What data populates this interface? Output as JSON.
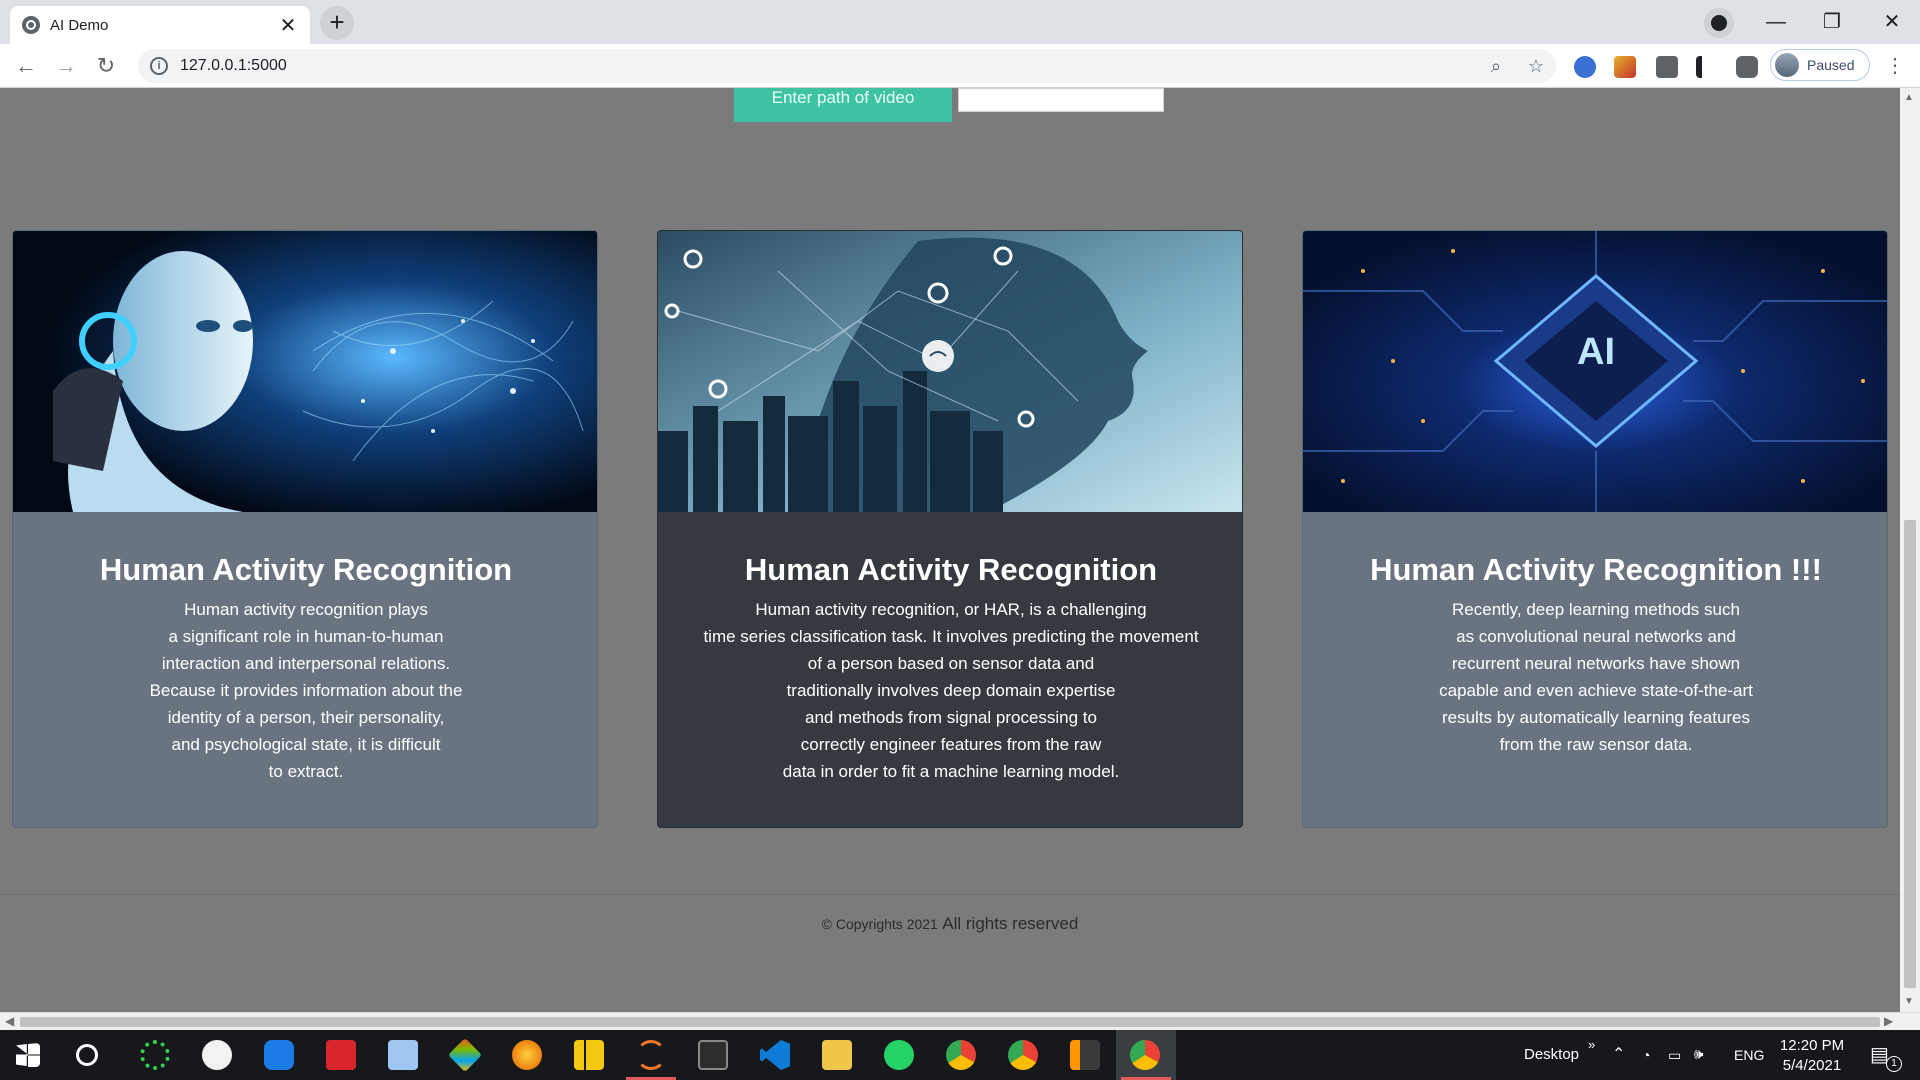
{
  "browser": {
    "tab_title": "AI Demo",
    "tab_close": "✕",
    "new_tab": "+",
    "url": "127.0.0.1:5000",
    "profile_label": "Paused",
    "window_minimize": "—",
    "window_restore": "❐",
    "window_close": "✕",
    "back": "←",
    "forward": "→",
    "reload": "↻",
    "menu": "⋮",
    "zoom_icon": "⌕",
    "star_icon": "☆"
  },
  "page": {
    "video_button_label": "Enter path of video",
    "video_input_value": "",
    "cards": [
      {
        "image_icon": "robot-brain-image",
        "heading": "Human Activity Recognition",
        "lines": [
          "Human activity recognition plays",
          "a significant role in human-to-human",
          "interaction and interpersonal relations.",
          "Because it provides information about the",
          "identity of a person, their personality,",
          "and psychological state, it is difficult",
          "to extract."
        ]
      },
      {
        "image_icon": "head-network-city-image",
        "heading": "Human Activity Recognition",
        "lines": [
          "Human activity recognition, or HAR, is a challenging",
          "time series classification task. It involves predicting the movement",
          "of a person based on sensor data and",
          "traditionally involves deep domain expertise",
          "and methods from signal processing to",
          "correctly engineer features from the raw",
          "data in order to fit a machine learning model."
        ]
      },
      {
        "image_icon": "ai-chip-image",
        "image_text": "AI",
        "heading": "Human Activity Recognition !!!",
        "lines": [
          "Recently, deep learning methods such",
          "as convolutional neural networks and",
          "recurrent neural networks have shown",
          "capable and even achieve state-of-the-art",
          "results by automatically learning features",
          "from the raw sensor data."
        ]
      }
    ],
    "footer": {
      "copyright_small": "© Copyrights 2021",
      "rights": "All rights reserved"
    }
  },
  "taskbar": {
    "desktop_label": "Desktop",
    "chevron": "»",
    "language": "ENG",
    "time": "12:20 PM",
    "date": "5/4/2021",
    "notification_count": "1"
  }
}
